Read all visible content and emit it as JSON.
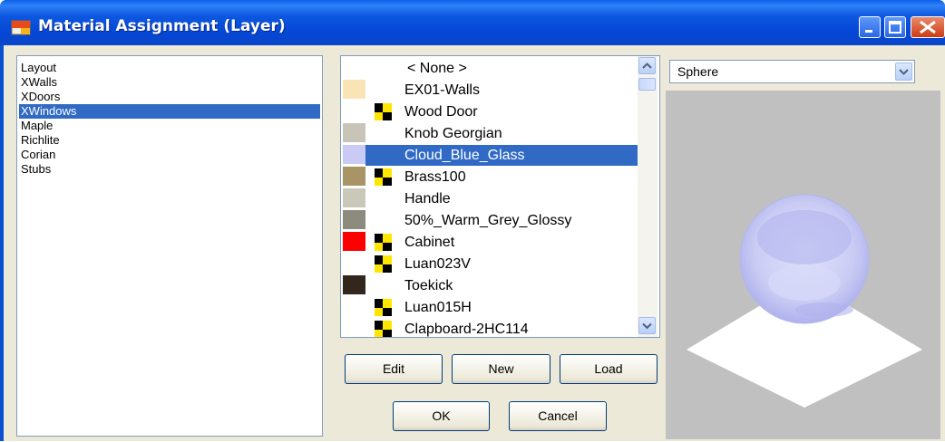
{
  "window": {
    "title": "Material Assignment (Layer)"
  },
  "layers": {
    "items": [
      {
        "label": "Layout",
        "selected": false
      },
      {
        "label": "XWalls",
        "selected": false
      },
      {
        "label": "XDoors",
        "selected": false
      },
      {
        "label": "XWindows",
        "selected": true
      },
      {
        "label": "Maple",
        "selected": false
      },
      {
        "label": "Richlite",
        "selected": false
      },
      {
        "label": "Corian",
        "selected": false
      },
      {
        "label": "Stubs",
        "selected": false
      }
    ]
  },
  "materials": {
    "items": [
      {
        "label": "< None >",
        "swatch": null,
        "texture_icon": false,
        "selected": false
      },
      {
        "label": "EX01-Walls",
        "swatch": "#f9e4b5",
        "texture_icon": false,
        "selected": false
      },
      {
        "label": "Wood Door",
        "swatch": null,
        "texture_icon": true,
        "selected": false
      },
      {
        "label": "Knob Georgian",
        "swatch": "#c8c5b8",
        "texture_icon": false,
        "selected": false
      },
      {
        "label": "Cloud_Blue_Glass",
        "swatch": "#c9cbf4",
        "texture_icon": false,
        "selected": true
      },
      {
        "label": "Brass100",
        "swatch": "#a99465",
        "texture_icon": true,
        "selected": false
      },
      {
        "label": "Handle",
        "swatch": "#c9c8b9",
        "texture_icon": false,
        "selected": false
      },
      {
        "label": "50%_Warm_Grey_Glossy",
        "swatch": "#8d8b7e",
        "texture_icon": false,
        "selected": false
      },
      {
        "label": "Cabinet",
        "swatch": "#ff0000",
        "texture_icon": true,
        "selected": false
      },
      {
        "label": "Luan023V",
        "swatch": null,
        "texture_icon": true,
        "selected": false
      },
      {
        "label": "Toekick",
        "swatch": "#33261c",
        "texture_icon": false,
        "selected": false
      },
      {
        "label": "Luan015H",
        "swatch": null,
        "texture_icon": true,
        "selected": false
      },
      {
        "label": "Clapboard-2HC114",
        "swatch": null,
        "texture_icon": true,
        "selected": false
      }
    ]
  },
  "buttons": {
    "edit": "Edit",
    "new": "New",
    "load": "Load",
    "ok": "OK",
    "cancel": "Cancel"
  },
  "preview": {
    "shape_value": "Sphere"
  },
  "colors": {
    "selection": "#316ac5",
    "dialog_bg": "#ece9d8",
    "preview_bg": "#c0c0c0",
    "glass": "#c9cbf4"
  }
}
